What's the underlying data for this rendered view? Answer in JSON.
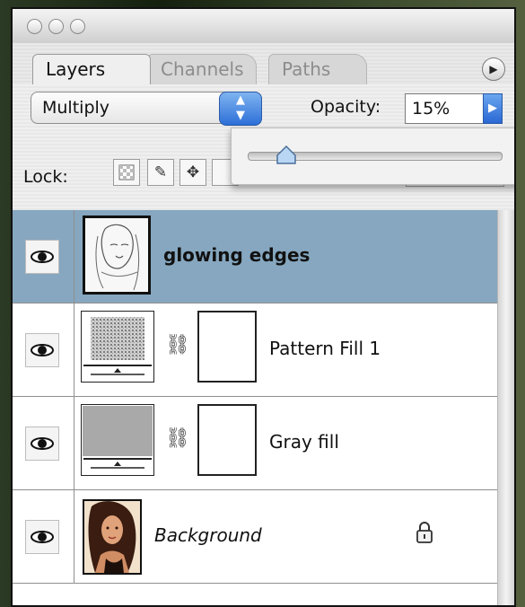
{
  "palette": {
    "tabs": [
      {
        "label": "Layers",
        "active": true
      },
      {
        "label": "Channels",
        "active": false
      },
      {
        "label": "Paths",
        "active": false
      }
    ],
    "menu_icon": "triangle-right-icon"
  },
  "toolbar": {
    "blend_mode": "Multiply",
    "opacity_label": "Opacity:",
    "opacity_value": "15%",
    "opacity_fraction": 0.15,
    "lock_label": "Lock:"
  },
  "layers": [
    {
      "name": "glowing edges",
      "selected": true,
      "visible": true,
      "bold": true
    },
    {
      "name": "Pattern Fill 1",
      "selected": false,
      "visible": true,
      "has_mask": true
    },
    {
      "name": "Gray fill",
      "selected": false,
      "visible": true,
      "has_mask": true
    },
    {
      "name": "Background",
      "selected": false,
      "visible": true,
      "italic": true,
      "locked": true
    }
  ],
  "colors": {
    "selection": "#86a7bf",
    "accent_blue": "#2d6fd8"
  }
}
